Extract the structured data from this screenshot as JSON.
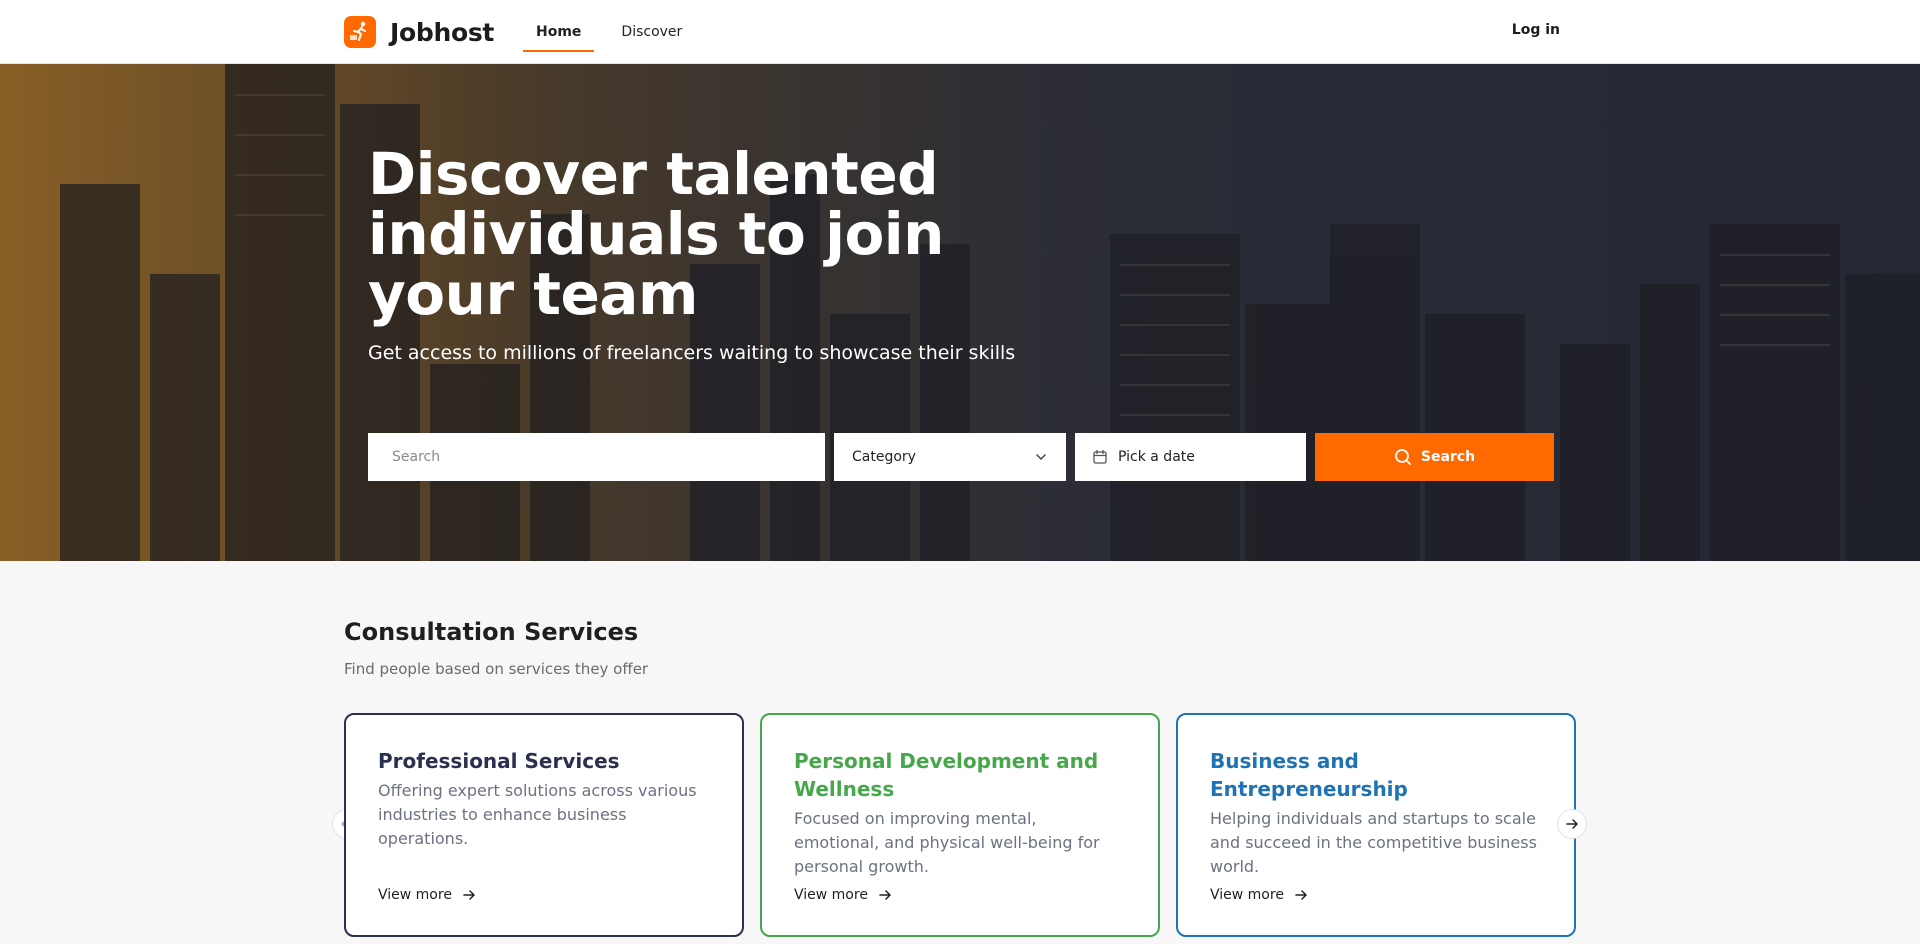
{
  "brand": {
    "name": "Jobhost",
    "accent": "#ff6a00"
  },
  "nav": {
    "items": [
      {
        "label": "Home",
        "active": true
      },
      {
        "label": "Discover",
        "active": false
      }
    ],
    "login_label": "Log in"
  },
  "hero": {
    "title": "Discover talented individuals to join your team",
    "subtitle": "Get access to millions of freelancers waiting to showcase their skills",
    "search": {
      "placeholder": "Search",
      "value": "",
      "category_label": "Category",
      "date_label": "Pick a date",
      "button_label": "Search"
    }
  },
  "section": {
    "title": "Consultation Services",
    "subtitle": "Find people based on services they offer",
    "cards": [
      {
        "title": "Professional Services",
        "description": "Offering expert solutions across various industries to enhance business operations.",
        "link": "View more",
        "color": "#2a3050"
      },
      {
        "title": "Personal Development and Wellness",
        "description": "Focused on improving mental, emotional, and physical well-being for personal growth.",
        "link": "View more",
        "color": "#46a84a"
      },
      {
        "title": "Business and Entrepreneurship",
        "description": "Helping individuals and startups to scale and succeed in the competitive business world.",
        "link": "View more",
        "color": "#1f73b3"
      }
    ]
  },
  "icons": {
    "logo": "runner-logo-icon",
    "category_chevron": "chevron-down-icon",
    "date": "calendar-icon",
    "search": "search-icon",
    "view_more": "arrow-right-icon",
    "prev": "arrow-left-icon",
    "next": "arrow-right-icon"
  }
}
